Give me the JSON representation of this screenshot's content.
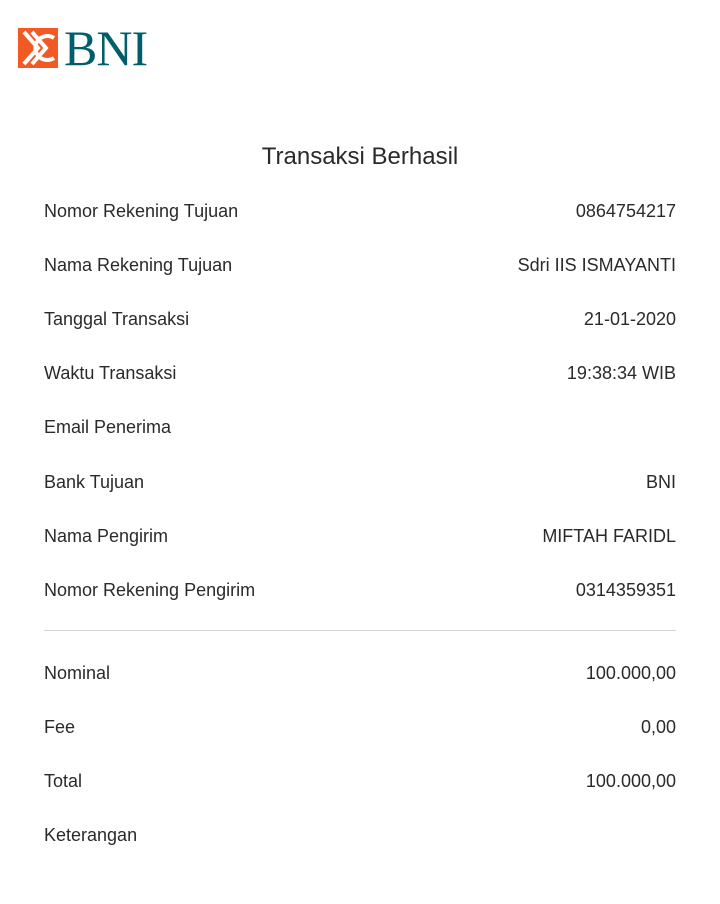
{
  "brand": {
    "name": "BNI",
    "mark_color": "#f15a22",
    "text_color": "#005e6a"
  },
  "title": "Transaksi Berhasil",
  "details": [
    {
      "label": "Nomor Rekening Tujuan",
      "value": "0864754217"
    },
    {
      "label": "Nama Rekening Tujuan",
      "value": "Sdri IIS ISMAYANTI"
    },
    {
      "label": "Tanggal Transaksi",
      "value": "21-01-2020"
    },
    {
      "label": "Waktu Transaksi",
      "value": "19:38:34 WIB"
    },
    {
      "label": "Email Penerima",
      "value": ""
    },
    {
      "label": "Bank Tujuan",
      "value": "BNI"
    },
    {
      "label": "Nama Pengirim",
      "value": "MIFTAH FARIDL"
    },
    {
      "label": "Nomor Rekening Pengirim",
      "value": "0314359351"
    }
  ],
  "amounts": [
    {
      "label": "Nominal",
      "value": "100.000,00"
    },
    {
      "label": "Fee",
      "value": "0,00"
    },
    {
      "label": "Total",
      "value": "100.000,00"
    },
    {
      "label": "Keterangan",
      "value": ""
    }
  ]
}
